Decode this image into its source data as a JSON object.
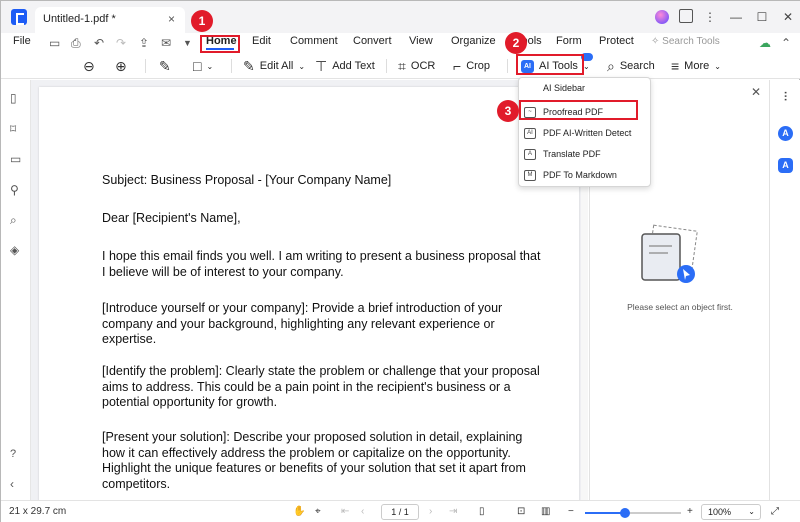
{
  "titlebar": {
    "tab_title": "Untitled-1.pdf *",
    "tab_close": "×",
    "add_tab": "+",
    "win_controls": [
      "⋮",
      "—",
      "☐",
      "✕"
    ]
  },
  "menubar": {
    "file": "File",
    "tabs": [
      "Home",
      "Edit",
      "Comment",
      "Convert",
      "View",
      "Organize",
      "Tools",
      "Form",
      "Protect"
    ],
    "search_tools": "Search Tools"
  },
  "toolbar": {
    "edit_all": "Edit All",
    "add_text": "Add Text",
    "ocr": "OCR",
    "crop": "Crop",
    "ai_tools": "AI Tools",
    "search": "Search",
    "more": "More"
  },
  "dropdown": {
    "header": "AI Sidebar",
    "items": [
      {
        "label": "Proofread PDF",
        "icon": "proofread-icon"
      },
      {
        "label": "PDF AI-Written Detect",
        "icon": "ai-detect-icon"
      },
      {
        "label": "Translate PDF",
        "icon": "translate-icon"
      },
      {
        "label": "PDF To Markdown",
        "icon": "markdown-icon"
      }
    ]
  },
  "markers": [
    "1",
    "2",
    "3"
  ],
  "document": {
    "subject": "Subject: Business Proposal - [Your Company Name]",
    "salutation": "Dear [Recipient's Name],",
    "p1": "I hope this email finds you well. I am writing to present a business proposal that I believe will be of interest to your company.",
    "p2": "[Introduce yourself or your company]: Provide a brief introduction of your company and your background, highlighting any relevant experience or expertise.",
    "p3": "[Identify the problem]: Clearly state the problem or challenge that your proposal aims to address. This could be a pain point in the recipient's business or a potential opportunity for growth.",
    "p4": "[Present your solution]: Describe your proposed solution in detail, explaining how it can effectively address the problem or capitalize on the opportunity. Highlight the unique features or benefits of your solution that set it apart from competitors."
  },
  "right_panel": {
    "empty_message": "Please select an object first."
  },
  "statusbar": {
    "page_size": "21 x 29.7 cm",
    "page_indicator": "1 / 1",
    "zoom": "100%",
    "zoom_level": 0.42
  },
  "colors": {
    "accent": "#1d5cf5",
    "annotation": "#e11b2a"
  }
}
